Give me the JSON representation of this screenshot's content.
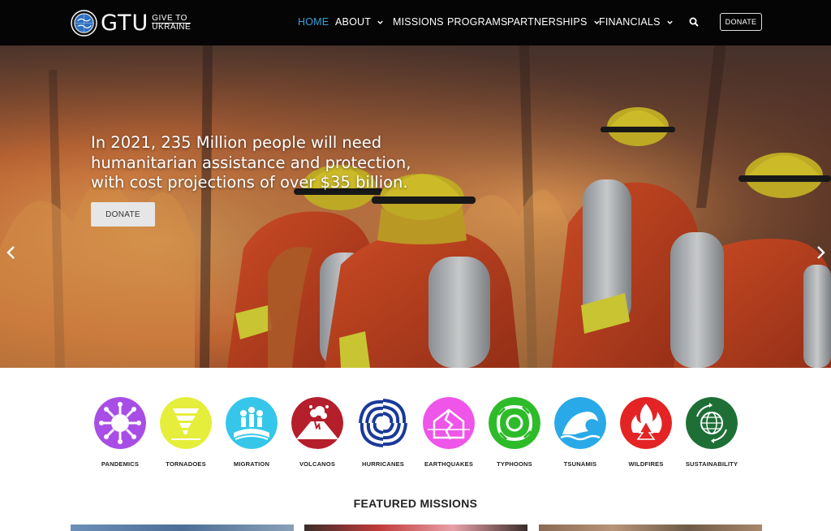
{
  "brand": {
    "logo_text": "GTU",
    "tag_line1": "GIVE TO",
    "tag_line2": "UKRAINE"
  },
  "nav": {
    "items": [
      {
        "label": "HOME",
        "active": true
      },
      {
        "label": "ABOUT",
        "dropdown": true
      },
      {
        "label": "MISSIONS"
      },
      {
        "label": "PROGRAMS"
      },
      {
        "label": "PARTNERSHIPS",
        "dropdown": true
      },
      {
        "label": "FINANCIALS",
        "dropdown": true
      }
    ],
    "search_icon": "search-icon",
    "donate_label": "DONATE"
  },
  "hero": {
    "headline": "In 2021, 235 Million people will need humanitarian assistance and protection, with cost projections of over $35 billion.",
    "donate_label": "DONATE"
  },
  "categories": [
    {
      "label": "PANDEMICS",
      "color": "#a84ee6"
    },
    {
      "label": "TORNADOES",
      "color": "#e5ee3a"
    },
    {
      "label": "MIGRATION",
      "color": "#35c6ea"
    },
    {
      "label": "VOLCANOS",
      "color": "#b51e2b"
    },
    {
      "label": "HURRICANES",
      "color": "#1a3a9a"
    },
    {
      "label": "EARTHQUAKES",
      "color": "#ee55e8"
    },
    {
      "label": "TYPHOONS",
      "color": "#2dbb2a"
    },
    {
      "label": "TSUNAMIS",
      "color": "#2aa9e8"
    },
    {
      "label": "WILDFIRES",
      "color": "#e42424"
    },
    {
      "label": "SUSTAINABILITY",
      "color": "#1e6f36"
    }
  ],
  "featured": {
    "title": "FEATURED MISSIONS"
  },
  "colors": {
    "nav_bg": "#050505",
    "active": "#3aa0d8"
  }
}
